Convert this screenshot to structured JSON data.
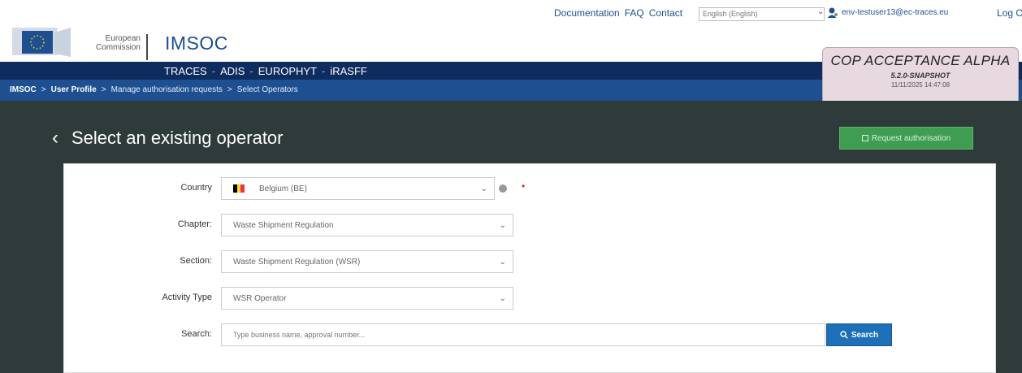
{
  "utility": {
    "links": [
      "Documentation",
      "FAQ",
      "Contact"
    ],
    "language": "English (English)",
    "user_email": "env-testuser13@ec-traces.eu",
    "logout": "Log Out"
  },
  "logo": {
    "line1": "European",
    "line2": "Commission",
    "brand": "IMSOC"
  },
  "nav": {
    "items": [
      "TRACES",
      "ADIS",
      "EUROPHYT",
      "iRASFF"
    ],
    "separator": "-"
  },
  "breadcrumb": {
    "root": "IMSOC",
    "items": [
      "User Profile",
      "Manage authorisation requests",
      "Select Operators"
    ],
    "separator": ">"
  },
  "env_badge": {
    "title": "COP ACCEPTANCE ALPHA",
    "version": "5.2.0-SNAPSHOT",
    "date": "11/11/2025 14:47:08"
  },
  "page": {
    "back_icon": "chevron-left-icon",
    "title": "Select an existing operator",
    "request_button": "Request authorisation"
  },
  "form": {
    "country": {
      "label": "Country",
      "value": "Belgium (BE)",
      "flag_colors": [
        "#000000",
        "#FDDA24",
        "#EF3340"
      ]
    },
    "chapter": {
      "label": "Chapter:",
      "value": "Waste Shipment Regulation"
    },
    "section": {
      "label": "Section:",
      "value": "Waste Shipment Regulation (WSR)"
    },
    "activity": {
      "label": "Activity Type",
      "value": "WSR Operator"
    },
    "search": {
      "label": "Search:",
      "placeholder": "Type business name, approval number...",
      "button": "Search"
    }
  },
  "colors": {
    "brand_blue": "#1d4f91",
    "nav_dark": "#0e2c5e",
    "content_dark": "#2f3b3a",
    "success_green": "#3f9d52",
    "search_blue": "#1d6fb8"
  }
}
